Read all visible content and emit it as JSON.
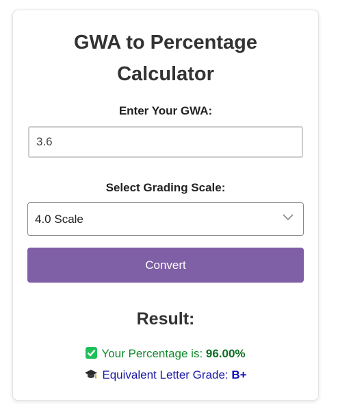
{
  "calculator": {
    "title_line1": "GWA to Percentage",
    "title_line2": "Calculator",
    "gwa_label": "Enter Your GWA:",
    "gwa_value": "3.6",
    "scale_label": "Select Grading Scale:",
    "scale_selected": "4.0 Scale",
    "convert_label": "Convert"
  },
  "result": {
    "heading": "Result:",
    "percentage_prefix": "Your Percentage is: ",
    "percentage_value": "96.00%",
    "grade_prefix": "Equivalent Letter Grade: ",
    "grade_value": "B+",
    "percentage_icon": "check-mark-button-icon",
    "grade_icon": "graduation-cap-icon"
  },
  "colors": {
    "accent": "#7f5fa6",
    "percentage_text": "#118a2d",
    "grade_text": "#1a1aa6"
  }
}
